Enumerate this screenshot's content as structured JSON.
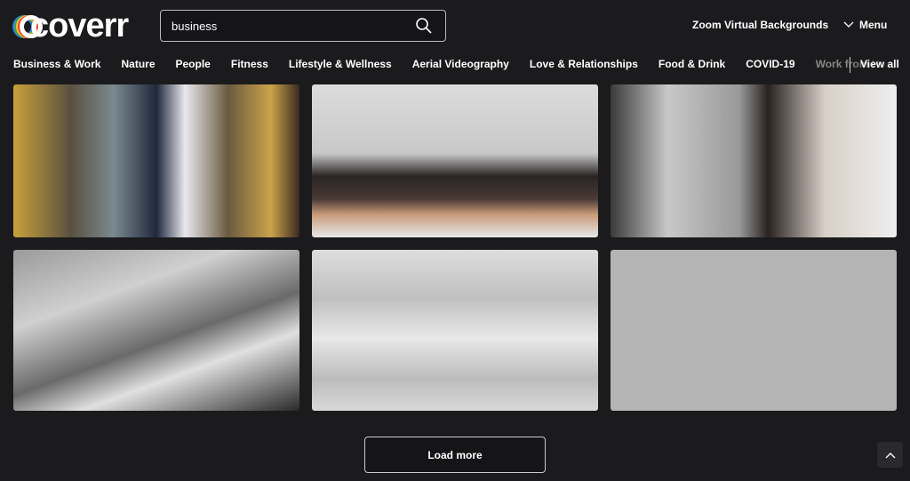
{
  "header": {
    "logo": "coverr",
    "search": {
      "value": "business"
    },
    "zoom_link": "Zoom Virtual Backgrounds",
    "menu": "Menu"
  },
  "categories": [
    "Business & Work",
    "Nature",
    "People",
    "Fitness",
    "Lifestyle & Wellness",
    "Aerial Videography",
    "Love & Relationships",
    "Food & Drink",
    "COVID-19",
    "Work from Home"
  ],
  "view_all": "View all",
  "videos": [
    "man-with-phone",
    "meeting-silhouettes",
    "blurred-office",
    "typing-laptop-bw",
    "keyboard-closeup",
    "grey-blank"
  ],
  "load_more": "Load more",
  "colors": {
    "background": "#1b1b1d",
    "logo_rings": [
      "#e8412c",
      "#f7c32e",
      "#3aa757",
      "#2f7de1"
    ]
  }
}
